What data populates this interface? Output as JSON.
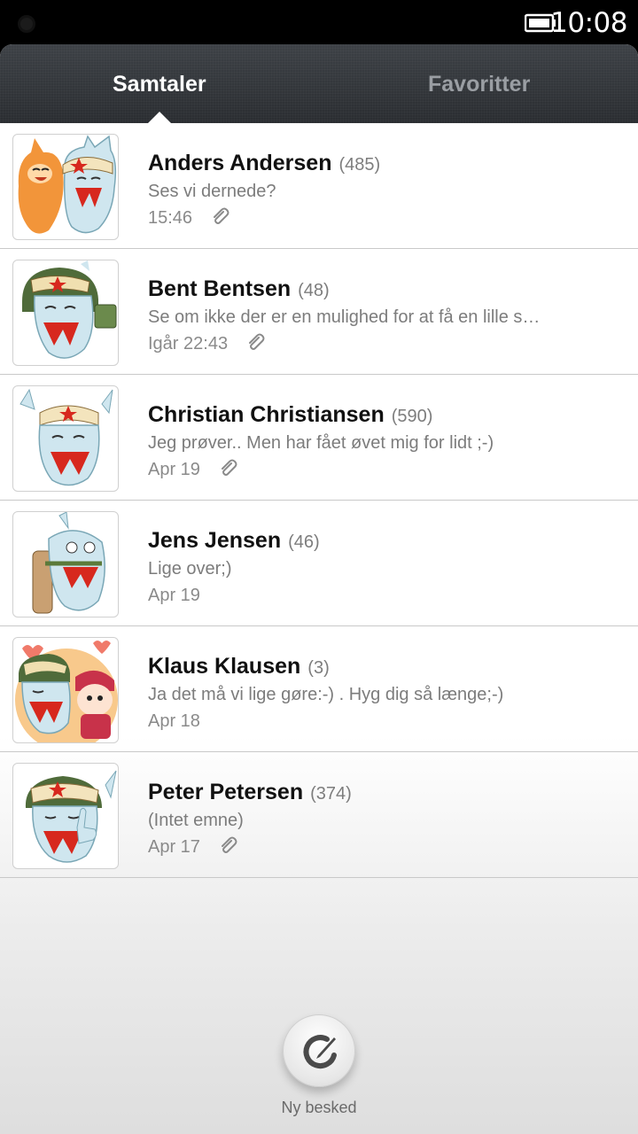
{
  "status_bar": {
    "time": "10:08",
    "battery_icon": "battery-icon"
  },
  "tabs": [
    {
      "label": "Samtaler",
      "active": true
    },
    {
      "label": "Favoritter",
      "active": false
    }
  ],
  "conversations": [
    {
      "name": "Anders Andersen",
      "count": "(485)",
      "preview": "Ses vi dernede?",
      "time": "15:46",
      "attachment": true,
      "avatar_icon": "mascot-duo-avatar"
    },
    {
      "name": "Bent Bentsen",
      "count": "(48)",
      "preview": "Se om ikke der er en mulighed for at få en lille s…",
      "time": "Igår 22:43",
      "attachment": true,
      "avatar_icon": "mascot-hat-avatar"
    },
    {
      "name": "Christian Christiansen",
      "count": "(590)",
      "preview": "Jeg prøver.. Men har fået øvet mig for lidt ;-)",
      "time": "Apr 19",
      "attachment": true,
      "avatar_icon": "mascot-wave-avatar"
    },
    {
      "name": "Jens Jensen",
      "count": "(46)",
      "preview": "Lige over;)",
      "time": "Apr 19",
      "attachment": false,
      "avatar_icon": "mascot-reach-avatar"
    },
    {
      "name": "Klaus Klausen",
      "count": "(3)",
      "preview": "Ja det må vi lige gøre:-) . Hyg dig så længe;-)",
      "time": "Apr 18",
      "attachment": false,
      "avatar_icon": "mascot-hearts-avatar"
    },
    {
      "name": "Peter Petersen",
      "count": "(374)",
      "preview": "(Intet emne)",
      "time": "Apr 17",
      "attachment": true,
      "avatar_icon": "mascot-thumb-avatar"
    }
  ],
  "compose": {
    "label": "Ny besked",
    "icon": "compose-icon"
  },
  "colors": {
    "tab_bar": "#33373b",
    "active_tab": "#ffffff",
    "inactive_tab": "#9a9ea3",
    "accent_red": "#d7281e",
    "mascot_blue": "#cfe6ef"
  }
}
